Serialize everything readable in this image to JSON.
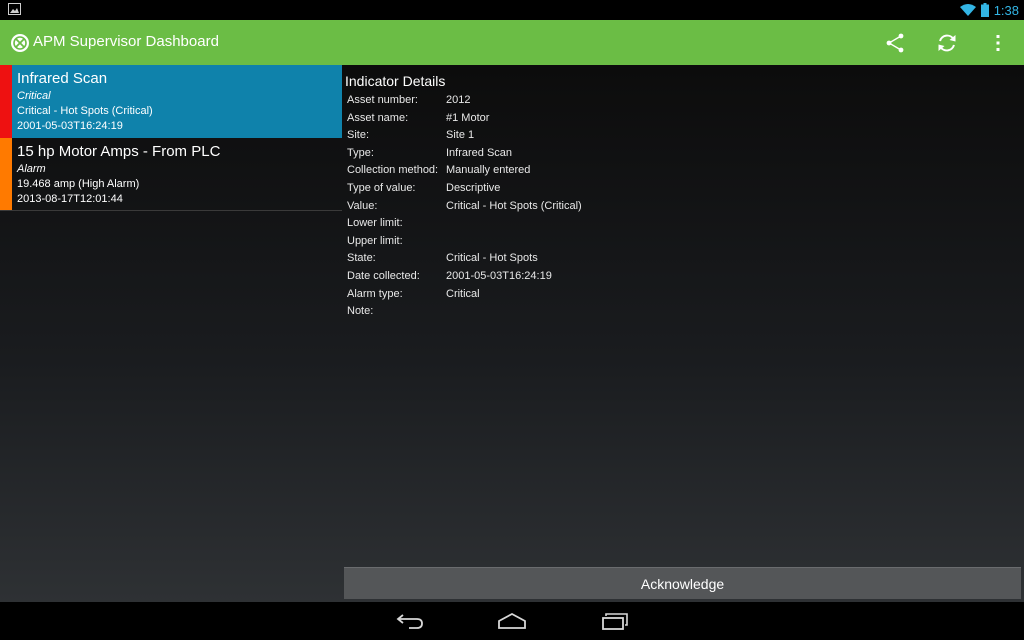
{
  "status_bar": {
    "time": "1:38",
    "notification_icon": "image-icon",
    "wifi_icon": "wifi-icon",
    "battery_icon": "battery-icon"
  },
  "action_bar": {
    "title": "APM Supervisor Dashboard",
    "background_color": "#6bbd45",
    "actions": [
      {
        "name": "share-icon"
      },
      {
        "name": "refresh-icon"
      },
      {
        "name": "overflow-menu-icon"
      }
    ]
  },
  "indicator_list": {
    "items": [
      {
        "title": "Infrared Scan",
        "severity": "Critical",
        "value": "Critical - Hot Spots (Critical)",
        "timestamp": "2001-05-03T16:24:19",
        "stripe_color": "#ee1111",
        "selected": true
      },
      {
        "title": "15 hp Motor Amps - From PLC",
        "severity": "Alarm",
        "value": "19.468 amp (High Alarm)",
        "timestamp": "2013-08-17T12:01:44",
        "stripe_color": "#ff7a00",
        "selected": false
      }
    ]
  },
  "details": {
    "heading": "Indicator Details",
    "rows": [
      {
        "label": "Asset number:",
        "value": "2012"
      },
      {
        "label": "Asset name:",
        "value": "#1 Motor"
      },
      {
        "label": "Site:",
        "value": "Site 1"
      },
      {
        "label": "Type:",
        "value": "Infrared Scan"
      },
      {
        "label": "Collection method:",
        "value": "Manually entered"
      },
      {
        "label": "Type of value:",
        "value": "Descriptive"
      },
      {
        "label": "Value:",
        "value": "Critical - Hot Spots (Critical)"
      },
      {
        "label": "Lower limit:",
        "value": ""
      },
      {
        "label": "Upper limit:",
        "value": ""
      },
      {
        "label": "State:",
        "value": "Critical - Hot Spots"
      },
      {
        "label": "Date collected:",
        "value": "2001-05-03T16:24:19"
      },
      {
        "label": "Alarm type:",
        "value": "Critical"
      },
      {
        "label": "Note:",
        "value": ""
      }
    ]
  },
  "acknowledge_button": {
    "label": "Acknowledge"
  },
  "nav_bar": {
    "buttons": [
      {
        "name": "back-icon"
      },
      {
        "name": "home-icon"
      },
      {
        "name": "recent-apps-icon"
      }
    ]
  }
}
